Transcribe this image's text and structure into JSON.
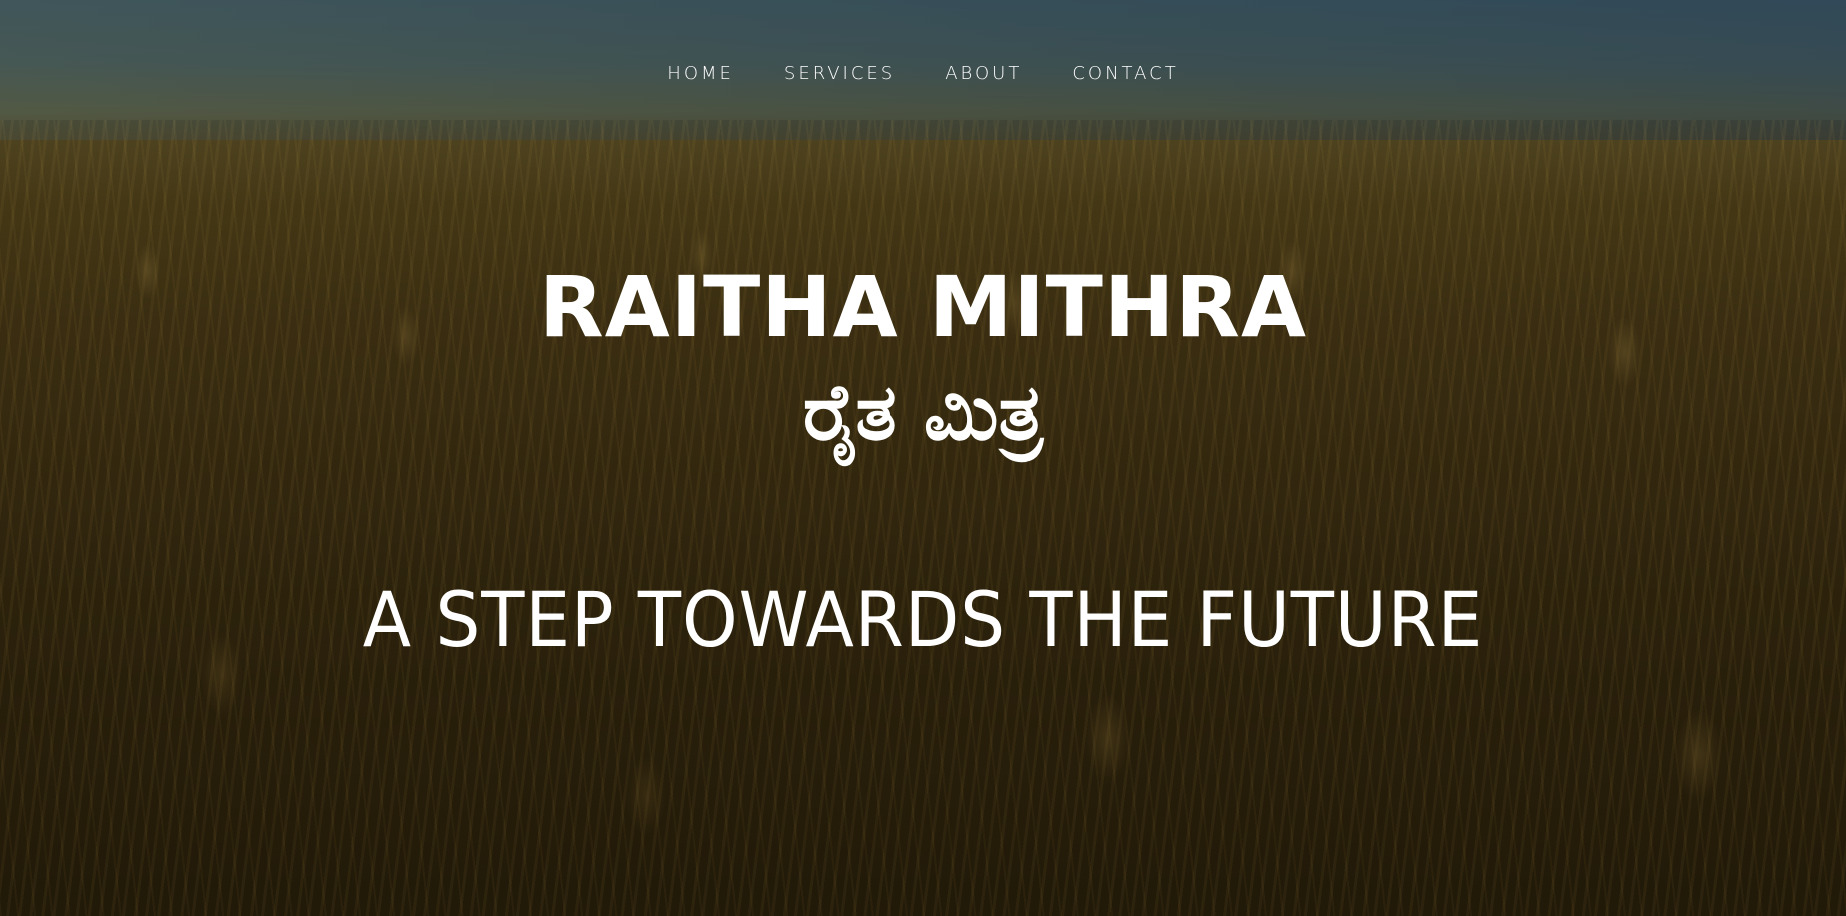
{
  "nav": {
    "items": [
      {
        "label": "HOME"
      },
      {
        "label": "SERVICES"
      },
      {
        "label": "ABOUT"
      },
      {
        "label": "CONTACT"
      }
    ]
  },
  "hero": {
    "title": "RAITHA MITHRA",
    "title_kannada": "ರೈತ ಮಿತ್ರ",
    "tagline": "A STEP TOWARDS THE FUTURE",
    "background": "wheat-field-photo"
  },
  "colors": {
    "text": "#ffffff",
    "overlay": "rgba(0,0,0,0.38)"
  }
}
